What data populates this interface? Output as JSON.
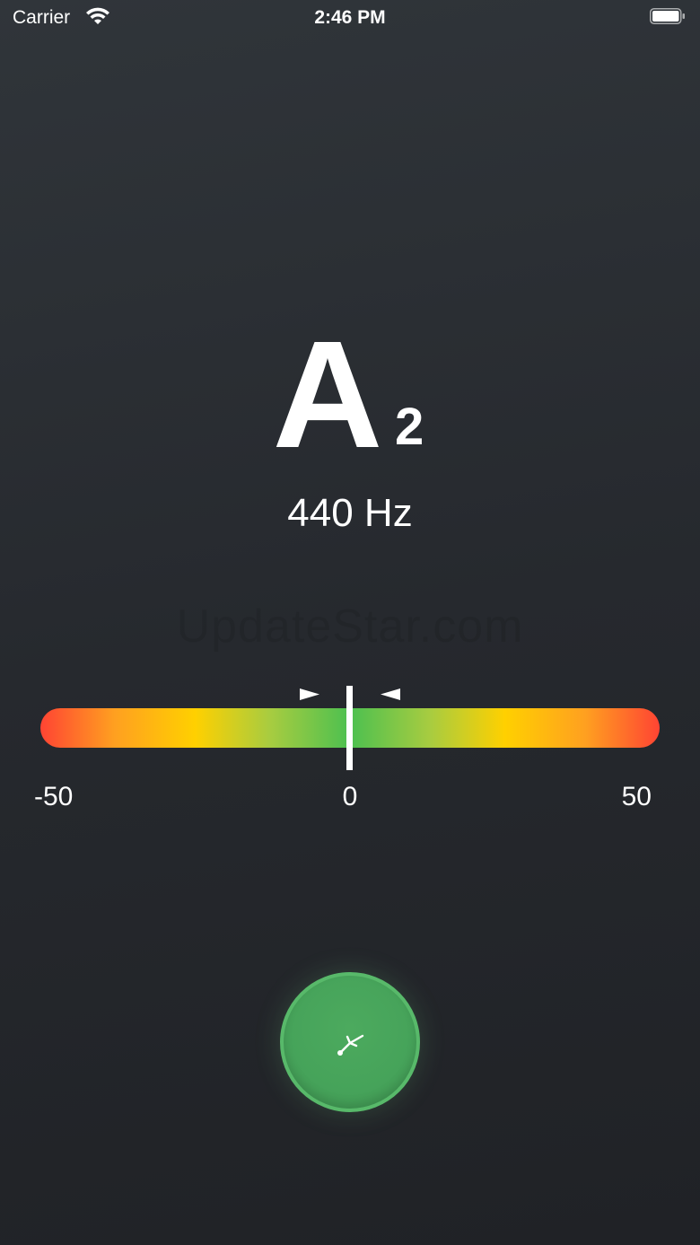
{
  "status_bar": {
    "carrier": "Carrier",
    "time": "2:46 PM",
    "icons": [
      "wifi-icon",
      "battery-icon"
    ]
  },
  "note": {
    "letter": "A",
    "octave": "2",
    "frequency": "440 Hz"
  },
  "watermark": "UpdateStar.com",
  "meter": {
    "min_label": "-50",
    "mid_label": "0",
    "max_label": "50",
    "value_cents": 0,
    "colors": {
      "edge": "#ff4433",
      "warn": "#ffd000",
      "center": "#4cc050"
    }
  },
  "fork_button": {
    "icon": "tuning-fork-icon",
    "color": "#46a35a"
  }
}
